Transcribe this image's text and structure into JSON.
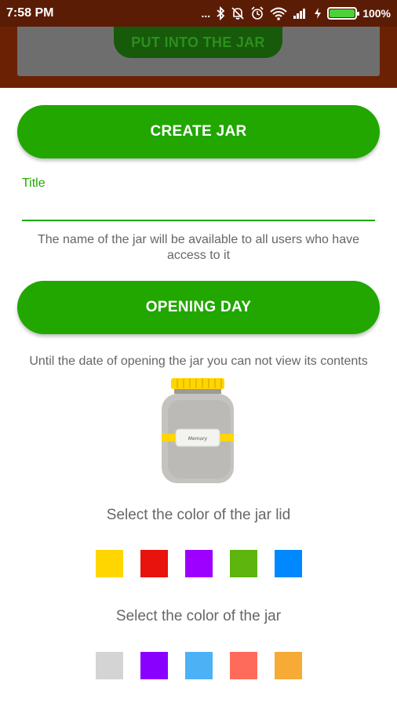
{
  "status_bar": {
    "time": "7:58 PM",
    "dots": "...",
    "battery_percent_label": "100%",
    "battery_level": 1.0,
    "icons": [
      "bluetooth-icon",
      "mute-icon",
      "alarm-icon",
      "wifi-icon",
      "signal-icon",
      "charging-icon",
      "battery-icon"
    ]
  },
  "background_app": {
    "button_label": "PUT INTO THE JAR"
  },
  "form": {
    "create_button_label": "CREATE JAR",
    "title_label": "Title",
    "title_value": "",
    "title_hint": "The name of the jar will be available to all users who have access to it",
    "opening_day_label": "OPENING DAY",
    "opening_hint": "Until the date of opening the jar you can not view its contents",
    "jar_label_text": "Memory",
    "lid_section_title": "Select the color of the jar lid",
    "jar_section_title": "Select the color of the jar"
  },
  "colors": {
    "accent": "#21a700",
    "lid_preview": "#ffd600",
    "jar_preview": "#c5c3bf"
  },
  "lid_colors": [
    "#ffd600",
    "#e8130c",
    "#9e00ff",
    "#5db50e",
    "#0088ff"
  ],
  "jar_colors": [
    "#d4d4d4",
    "#8a00ff",
    "#4cb2f5",
    "#ff6b5b",
    "#f5ab35"
  ]
}
